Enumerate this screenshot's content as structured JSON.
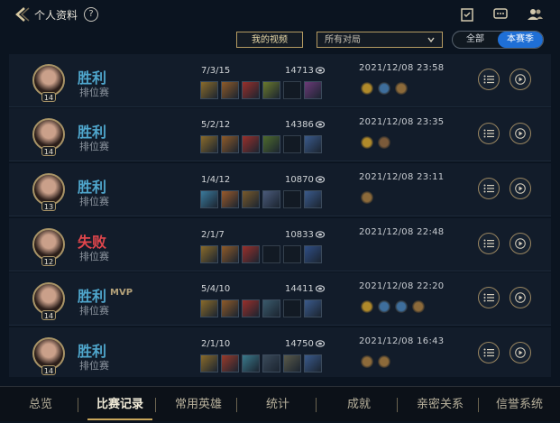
{
  "header": {
    "back_icon": "chevron-left-icon",
    "title": "个人资料",
    "help": "?",
    "right_icons": [
      "task-checklist-icon",
      "chat-icon",
      "friends-icon"
    ]
  },
  "filters": {
    "my_videos": "我的视频",
    "match_filter": "所有对局",
    "seg_all": "全部",
    "seg_season": "本赛季"
  },
  "matches": [
    {
      "result": "胜利",
      "outcome": "win",
      "mvp": "",
      "mode": "排位赛",
      "level": "14",
      "kda": "7/3/15",
      "gold": "14713",
      "date": "2021/12/08 23:58",
      "items": [
        "#8a6b2a",
        "#8f5a28",
        "#9a2f2a",
        "#6b7a2c",
        "",
        "#6b3a78"
      ],
      "badges": [
        "#b08a2a",
        "#3e6e9c",
        "#8c6a3a"
      ]
    },
    {
      "result": "胜利",
      "outcome": "win",
      "mvp": "",
      "mode": "排位赛",
      "level": "14",
      "kda": "5/2/12",
      "gold": "14386",
      "date": "2021/12/08 23:35",
      "items": [
        "#8a6b2a",
        "#8f5a28",
        "#9a2f2a",
        "#4e6b2c",
        "",
        "#3a5a8c"
      ],
      "badges": [
        "#b08a2a",
        "#7a5a3a"
      ]
    },
    {
      "result": "胜利",
      "outcome": "win",
      "mvp": "",
      "mode": "排位赛",
      "level": "13",
      "kda": "1/4/12",
      "gold": "10870",
      "date": "2021/12/08 23:11",
      "items": [
        "#3a7a9c",
        "#9a5a2a",
        "#7a5a2a",
        "#4a5a7a",
        "",
        "#3a5a8c"
      ],
      "badges": [
        "#8c6a3a"
      ]
    },
    {
      "result": "失败",
      "outcome": "loss",
      "mvp": "",
      "mode": "排位赛",
      "level": "12",
      "kda": "2/1/7",
      "gold": "10833",
      "date": "2021/12/08 22:48",
      "items": [
        "#8a6b2a",
        "#8f5a28",
        "#9a2f2a",
        "",
        "",
        "#2f4e86"
      ],
      "badges": []
    },
    {
      "result": "胜利",
      "outcome": "win",
      "mvp": "MVP",
      "mode": "排位赛",
      "level": "14",
      "kda": "5/4/10",
      "gold": "14411",
      "date": "2021/12/08 22:20",
      "items": [
        "#8a6b2a",
        "#8f5a28",
        "#9a2f2a",
        "#3a5a6c",
        "",
        "#3a5a8c"
      ],
      "badges": [
        "#b08a2a",
        "#3e6e9c",
        "#3e6e9c",
        "#8c6a3a"
      ]
    },
    {
      "result": "胜利",
      "outcome": "win",
      "mvp": "",
      "mode": "排位赛",
      "level": "14",
      "kda": "2/1/10",
      "gold": "14750",
      "date": "2021/12/08 16:43",
      "items": [
        "#8a6b2a",
        "#9a3a2a",
        "#3a7a8c",
        "#3a4a5a",
        "#5a5a4a",
        "#3a5a8c"
      ],
      "badges": [
        "#8c6a3a",
        "#8c6a3a"
      ]
    }
  ],
  "row_actions": {
    "details_icon": "list-icon",
    "replay_icon": "play-icon"
  },
  "nav": [
    "总览",
    "比赛记录",
    "常用英雄",
    "统计",
    "成就",
    "亲密关系",
    "信誉系统"
  ],
  "nav_active": "比赛记录"
}
